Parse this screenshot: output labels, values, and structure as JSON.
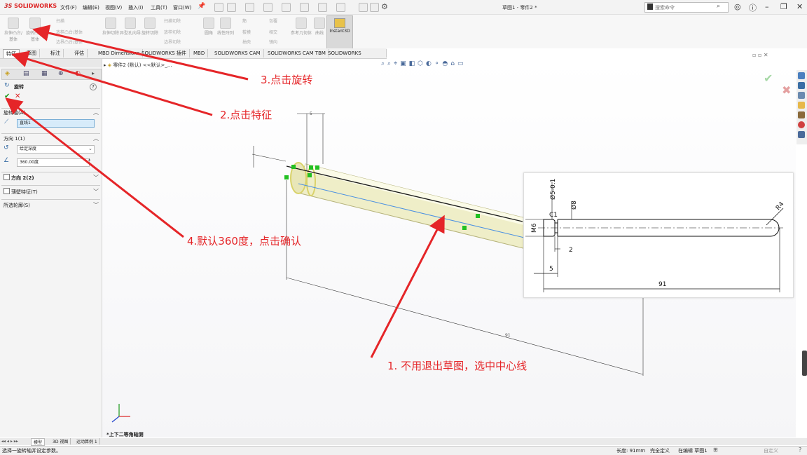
{
  "app": {
    "brand_ds": "3S",
    "brand_name": "SOLIDWORKS",
    "doc_title": "草图1 - 零件2 *",
    "search_placeholder": "搜索命令"
  },
  "menu": [
    "文件(F)",
    "编辑(E)",
    "视图(V)",
    "插入(I)",
    "工具(T)",
    "窗口(W)"
  ],
  "ribbon": {
    "left_group": [
      "拉伸凸台/基体",
      "旋转凸台/基体"
    ],
    "mid_items": [
      "扫描",
      "放样凸台/基体",
      "边界凸台/基体"
    ],
    "cut_items": [
      "拉伸切除",
      "异型孔向导",
      "旋转切除",
      "扫描切除",
      "放样切除",
      "边界切除"
    ],
    "feat_items": [
      "圆角",
      "线性阵列",
      "筋",
      "拔模",
      "抽壳",
      "包覆",
      "相交",
      "镜向"
    ],
    "ref_items": [
      "参考几何体",
      "曲线"
    ],
    "instant3d": "Instant3D"
  },
  "tabs": [
    "特征",
    "草图",
    "标注",
    "评估",
    "MBD Dimensions",
    "SOLIDWORKS 插件",
    "MBD",
    "SOLIDWORKS CAM",
    "SOLIDWORKS CAM TBM",
    "SOLIDWORKS Inspection"
  ],
  "tree_breadcrumb": "零件2 (默认) <<默认>_...",
  "panel": {
    "feature_title": "旋转",
    "help": "?",
    "axis_header": "旋转轴(A)",
    "axis_value": "直线1",
    "dir1_header": "方向 1(1)",
    "dir1_type": "给定深度",
    "dir1_angle": "360.00度",
    "dir2_label": "方向 2(2)",
    "thin_label": "薄壁特征(T)",
    "contours_label": "所选轮廓(S)"
  },
  "viewport": {
    "view_label": "*上下二等角轴测",
    "sketch_dim_short": "5",
    "sketch_dim_long": "91"
  },
  "drawing": {
    "thread": "M6",
    "chamfer": "C1",
    "neck_dia": "Ø5-0.1",
    "shaft_dia": "Ø8",
    "radius": "R4",
    "len_small": "2",
    "len_thread": "5",
    "len_total": "91"
  },
  "annotations": {
    "step1": "1. 不用退出草图，选中中心线",
    "step2": "2.点击特征",
    "step3": "3.点击旋转",
    "step4": "4.默认360度，点击确认",
    "color": "#e52528"
  },
  "bottom_tabs": [
    "模型",
    "3D 视图",
    "运动算例 1"
  ],
  "status": {
    "message": "选择一旋转轴并设定参数。",
    "length": "长度: 91mm",
    "state": "完全定义",
    "editing": "在编辑 草图1",
    "units": "自定义"
  }
}
